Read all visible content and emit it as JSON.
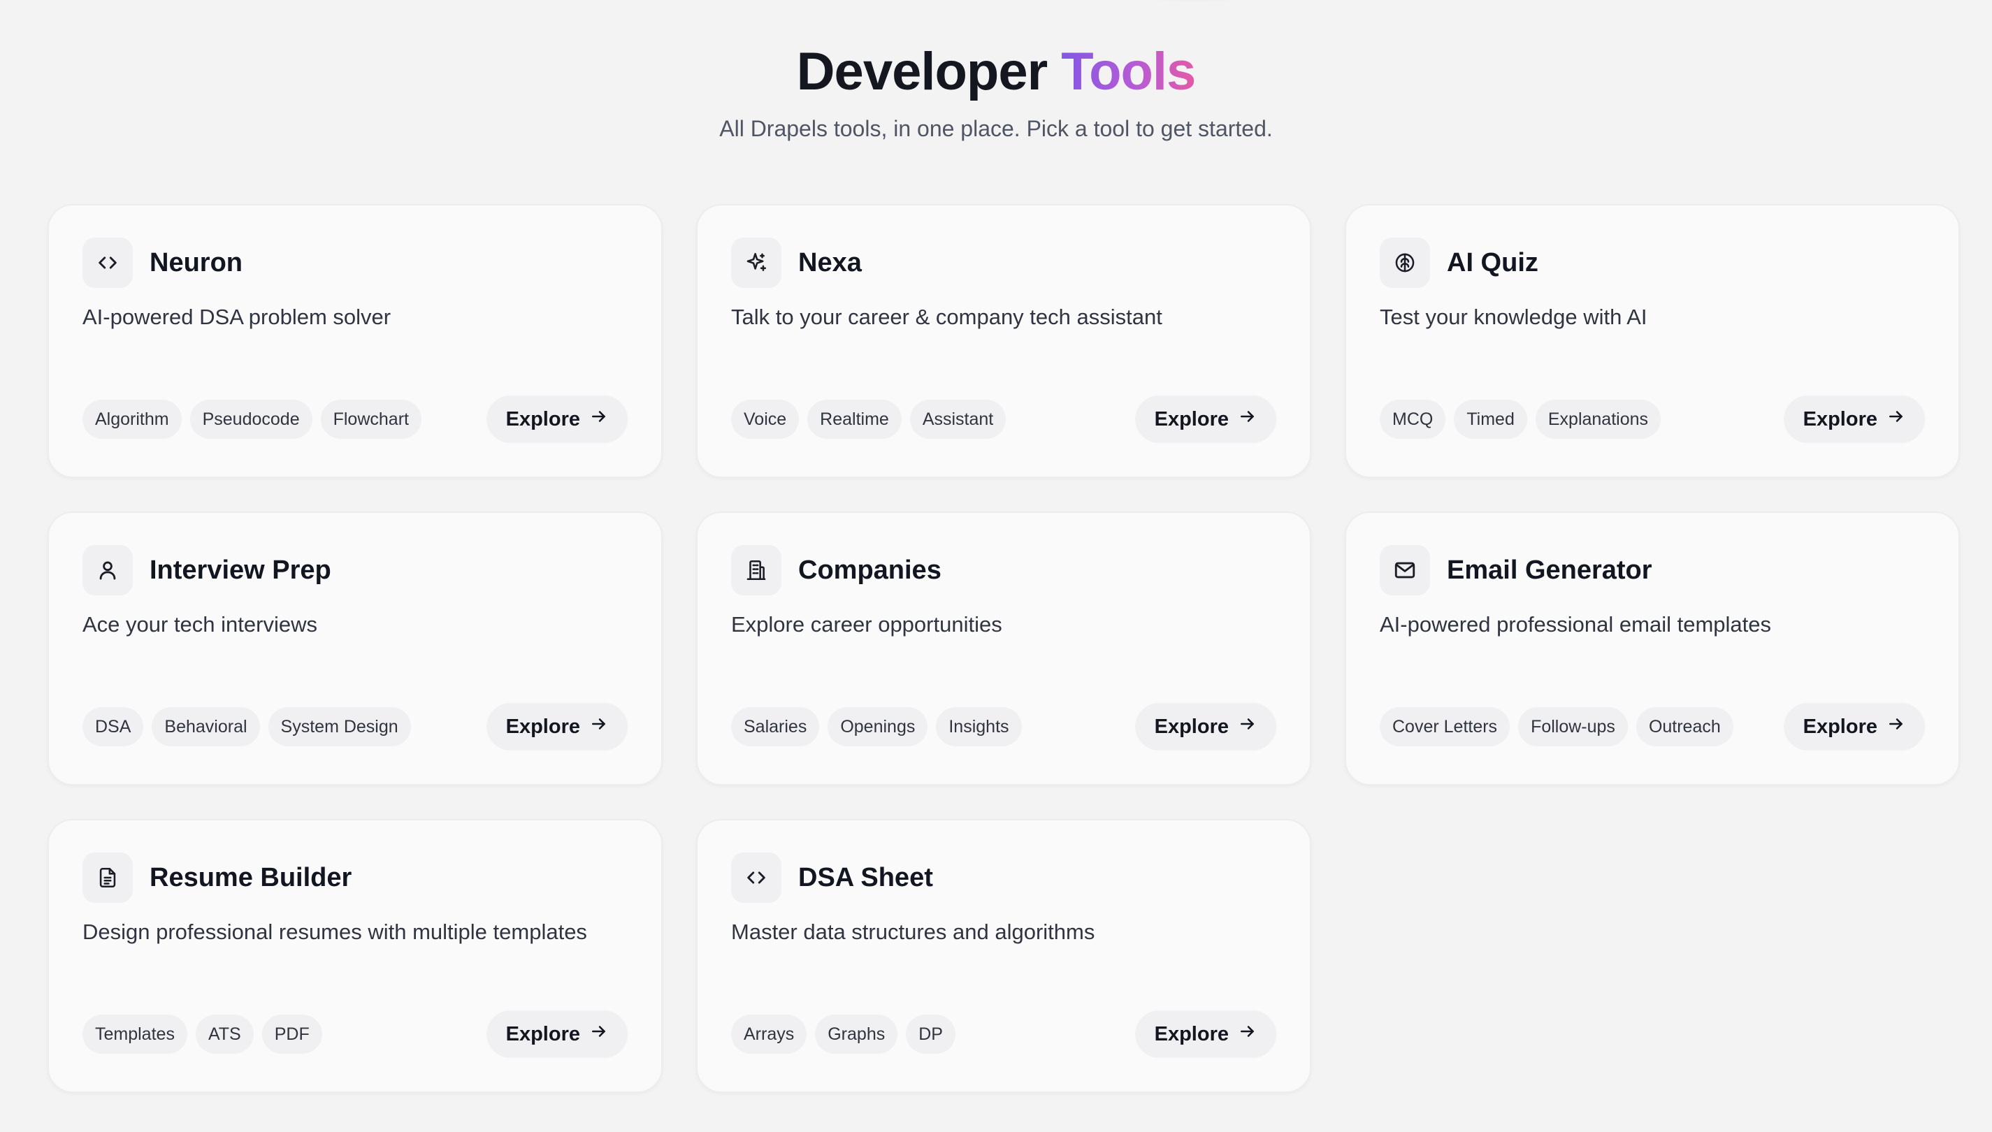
{
  "header": {
    "title_main": "Developer",
    "title_accent": "Tools",
    "subtitle": "All Drapels tools, in one place. Pick a tool to get started."
  },
  "colors": {
    "accent_gradient_start": "#8257e6",
    "accent_gradient_end": "#e25aa7",
    "background": "#f3f3f4",
    "card": "#fafafa"
  },
  "tools": [
    {
      "icon": "code-icon",
      "title": "Neuron",
      "description": "AI-powered DSA problem solver",
      "tags": [
        "Algorithm",
        "Pseudocode",
        "Flowchart"
      ],
      "action": "Explore"
    },
    {
      "icon": "sparkle-icon",
      "title": "Nexa",
      "description": "Talk to your career & company tech assistant",
      "tags": [
        "Voice",
        "Realtime",
        "Assistant"
      ],
      "action": "Explore"
    },
    {
      "icon": "brain-icon",
      "title": "AI Quiz",
      "description": "Test your knowledge with AI",
      "tags": [
        "MCQ",
        "Timed",
        "Explanations"
      ],
      "action": "Explore"
    },
    {
      "icon": "user-icon",
      "title": "Interview Prep",
      "description": "Ace your tech interviews",
      "tags": [
        "DSA",
        "Behavioral",
        "System Design"
      ],
      "action": "Explore"
    },
    {
      "icon": "building-icon",
      "title": "Companies",
      "description": "Explore career opportunities",
      "tags": [
        "Salaries",
        "Openings",
        "Insights"
      ],
      "action": "Explore"
    },
    {
      "icon": "mail-icon",
      "title": "Email Generator",
      "description": "AI-powered professional email templates",
      "tags": [
        "Cover Letters",
        "Follow-ups",
        "Outreach"
      ],
      "action": "Explore"
    },
    {
      "icon": "document-icon",
      "title": "Resume Builder",
      "description": "Design professional resumes with multiple templates",
      "tags": [
        "Templates",
        "ATS",
        "PDF"
      ],
      "action": "Explore"
    },
    {
      "icon": "code-icon",
      "title": "DSA Sheet",
      "description": "Master data structures and algorithms",
      "tags": [
        "Arrays",
        "Graphs",
        "DP"
      ],
      "action": "Explore"
    }
  ]
}
